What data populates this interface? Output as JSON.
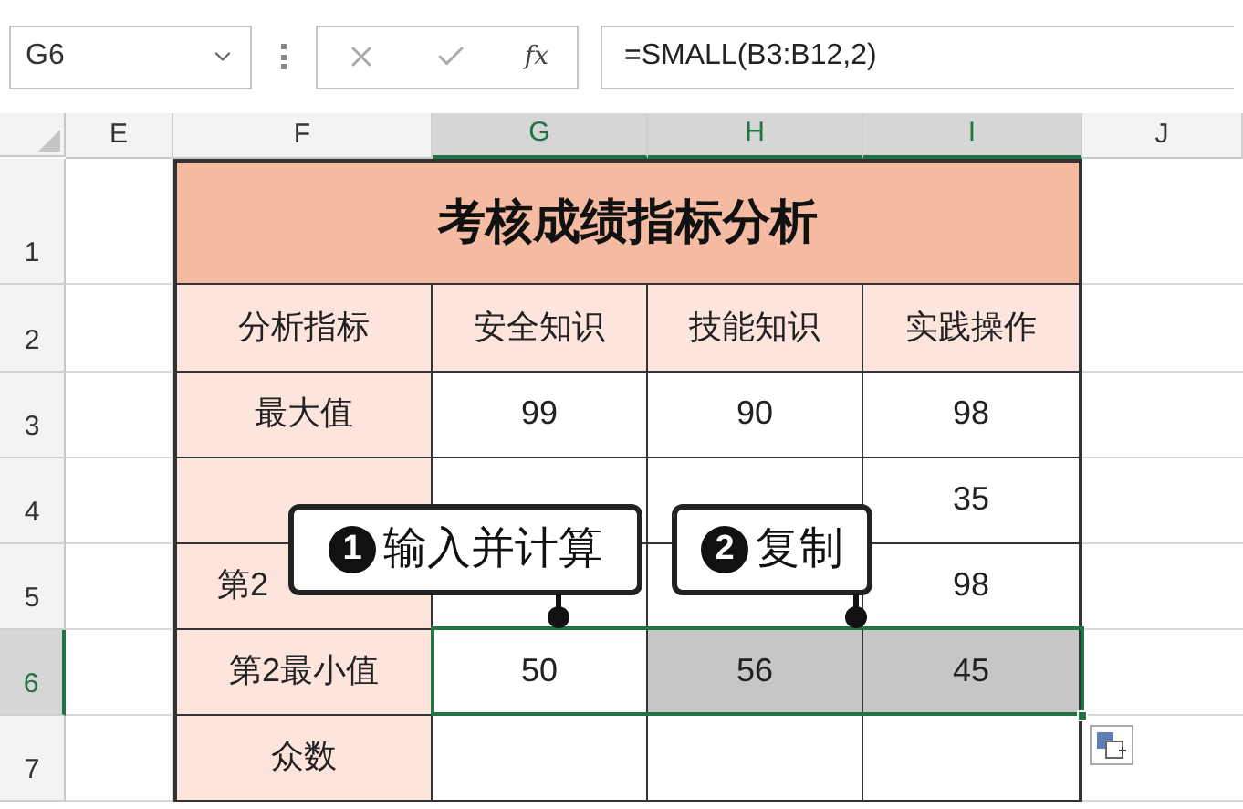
{
  "name_box": "G6",
  "formula_bar": {
    "function_label": "fx",
    "formula": "=SMALL(B3:B12,2)"
  },
  "columns": [
    {
      "label": "E",
      "selected": false
    },
    {
      "label": "F",
      "selected": false
    },
    {
      "label": "G",
      "selected": true
    },
    {
      "label": "H",
      "selected": true
    },
    {
      "label": "I",
      "selected": true
    },
    {
      "label": "J",
      "selected": false
    }
  ],
  "title_row": {
    "header": "1",
    "selected": false,
    "title": "考核成绩指标分析"
  },
  "rows": [
    {
      "header": "2",
      "selected": false,
      "cells": [
        {
          "text": "分析指标",
          "kind": "label",
          "selected": false
        },
        {
          "text": "安全知识",
          "kind": "label",
          "selected": false
        },
        {
          "text": "技能知识",
          "kind": "label",
          "selected": false
        },
        {
          "text": "实践操作",
          "kind": "label",
          "selected": false
        }
      ]
    },
    {
      "header": "3",
      "selected": false,
      "cells": [
        {
          "text": "最大值",
          "kind": "label",
          "selected": false
        },
        {
          "text": "99",
          "kind": "value",
          "selected": false
        },
        {
          "text": "90",
          "kind": "value",
          "selected": false
        },
        {
          "text": "98",
          "kind": "value",
          "selected": false
        }
      ]
    },
    {
      "header": "4",
      "selected": false,
      "cells": [
        {
          "kind": "label",
          "selected": false
        },
        {
          "kind": "value",
          "selected": false
        },
        {
          "kind": "value",
          "selected": false
        },
        {
          "text": "35",
          "kind": "value",
          "selected": false
        }
      ]
    },
    {
      "header": "5",
      "selected": false,
      "cells": [
        {
          "text": "第2",
          "kind": "clipped_label",
          "selected": false
        },
        {
          "kind": "value",
          "selected": false
        },
        {
          "kind": "value",
          "selected": false
        },
        {
          "text": "98",
          "kind": "value",
          "selected": false
        }
      ]
    },
    {
      "header": "6",
      "selected": true,
      "range_selected": true,
      "cells": [
        {
          "text": "第2最小值",
          "kind": "label",
          "selected": false
        },
        {
          "text": "50",
          "kind": "value",
          "selected": false
        },
        {
          "text": "56",
          "kind": "value",
          "selected": true
        },
        {
          "text": "45",
          "kind": "value",
          "selected": true
        }
      ]
    },
    {
      "header": "7",
      "selected": false,
      "cells": [
        {
          "text": "众数",
          "kind": "label",
          "selected": false
        },
        {
          "kind": "value",
          "selected": false
        },
        {
          "kind": "value",
          "selected": false
        },
        {
          "kind": "value",
          "selected": false
        }
      ]
    }
  ],
  "callouts": [
    {
      "number": "1",
      "text": "输入并计算"
    },
    {
      "number": "2",
      "text": "复制"
    }
  ]
}
